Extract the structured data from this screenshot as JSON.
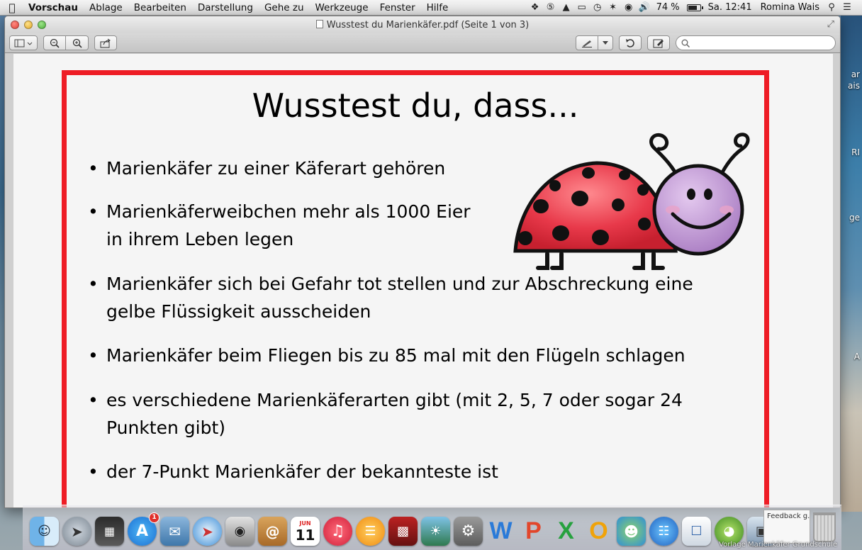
{
  "menubar": {
    "app_name": "Vorschau",
    "items": [
      "Ablage",
      "Bearbeiten",
      "Darstellung",
      "Gehe zu",
      "Werkzeuge",
      "Fenster",
      "Hilfe"
    ],
    "battery_text": "74 %",
    "clock": "Sa. 12:41",
    "user": "Romina Wais"
  },
  "window": {
    "title": "Wusstest du Marienkäfer.pdf (Seite 1 von 3)"
  },
  "toolbar": {
    "search_placeholder": ""
  },
  "slide": {
    "title": "Wusstest du, dass...",
    "bullets": [
      {
        "line1": "Marienkäfer zu einer Käferart gehören"
      },
      {
        "line1": "Marienkäferweibchen mehr als 1000 Eier",
        "line2": "in ihrem Leben legen"
      },
      {
        "line1": "Marienkäfer sich bei Gefahr tot stellen und zur Abschreckung eine",
        "line2": "gelbe Flüssigkeit ausscheiden"
      },
      {
        "line1": "Marienkäfer beim Fliegen bis zu 85 mal mit den Flügeln schlagen"
      },
      {
        "line1": "es verschiedene Marienkäferarten gibt (mit 2, 5, 7 oder sogar 24",
        "line2": "Punkten gibt)"
      },
      {
        "line1": "der 7-Punkt Marienkäfer der bekannteste ist"
      }
    ]
  },
  "desktop": {
    "fragments": [
      "ar",
      "ais",
      "RI",
      "ge",
      "A"
    ]
  },
  "dock": {
    "feedback_label": "Feedback g...",
    "appstore_badge": "1",
    "calendar_month": "JUN",
    "calendar_day": "11",
    "watermark": "Vorlage Marienkäfer Grundschule"
  },
  "colors": {
    "frame_red": "#ee1c25",
    "ladybug_red": "#e8394a",
    "face_purple": "#c39ad6"
  }
}
